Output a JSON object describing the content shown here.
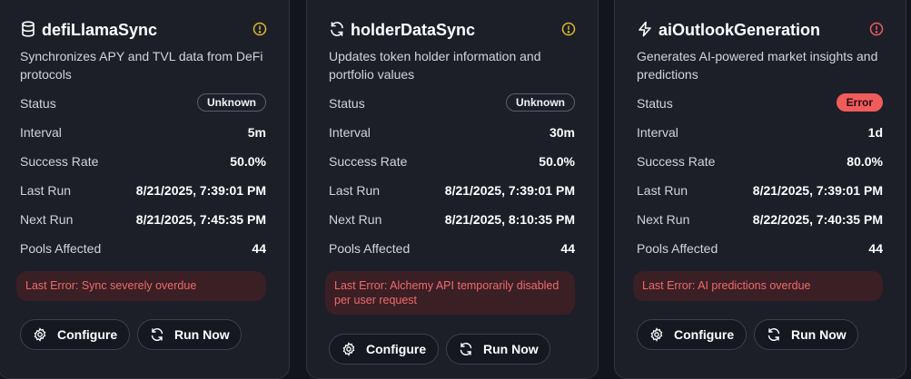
{
  "colors": {
    "background": "#12151d",
    "card": "#1c1f28",
    "warning": "#e0b72a",
    "error": "#f05c5c",
    "error_bg": "#3a1f25"
  },
  "cards": [
    {
      "icon": "database-icon",
      "title": "defiLlamaSync",
      "status_icon": "warning-circle-icon",
      "description": "Synchronizes APY and TVL data from DeFi protocols",
      "rows": [
        {
          "label": "Status",
          "value": "Unknown"
        },
        {
          "label": "Interval",
          "value": "5m"
        },
        {
          "label": "Success Rate",
          "value": "50.0%"
        },
        {
          "label": "Last Run",
          "value": "8/21/2025, 7:39:01 PM"
        },
        {
          "label": "Next Run",
          "value": "8/21/2025, 7:45:35 PM"
        },
        {
          "label": "Pools Affected",
          "value": "44"
        }
      ],
      "last_error": "Last Error: Sync severely overdue",
      "configure_label": "Configure",
      "run_now_label": "Run Now"
    },
    {
      "icon": "refresh-icon",
      "title": "holderDataSync",
      "status_icon": "warning-circle-icon",
      "description": "Updates token holder information and portfolio values",
      "rows": [
        {
          "label": "Status",
          "value": "Unknown"
        },
        {
          "label": "Interval",
          "value": "30m"
        },
        {
          "label": "Success Rate",
          "value": "50.0%"
        },
        {
          "label": "Last Run",
          "value": "8/21/2025, 7:39:01 PM"
        },
        {
          "label": "Next Run",
          "value": "8/21/2025, 8:10:35 PM"
        },
        {
          "label": "Pools Affected",
          "value": "44"
        }
      ],
      "last_error": "Last Error: Alchemy API temporarily disabled per user request",
      "configure_label": "Configure",
      "run_now_label": "Run Now"
    },
    {
      "icon": "lightning-icon",
      "title": "aiOutlookGeneration",
      "status_icon": "error-circle-icon",
      "description": "Generates AI-powered market insights and predictions",
      "rows": [
        {
          "label": "Status",
          "value": "Error"
        },
        {
          "label": "Interval",
          "value": "1d"
        },
        {
          "label": "Success Rate",
          "value": "80.0%"
        },
        {
          "label": "Last Run",
          "value": "8/21/2025, 7:39:01 PM"
        },
        {
          "label": "Next Run",
          "value": "8/22/2025, 7:40:35 PM"
        },
        {
          "label": "Pools Affected",
          "value": "44"
        }
      ],
      "last_error": "Last Error: AI predictions overdue",
      "configure_label": "Configure",
      "run_now_label": "Run Now"
    }
  ]
}
